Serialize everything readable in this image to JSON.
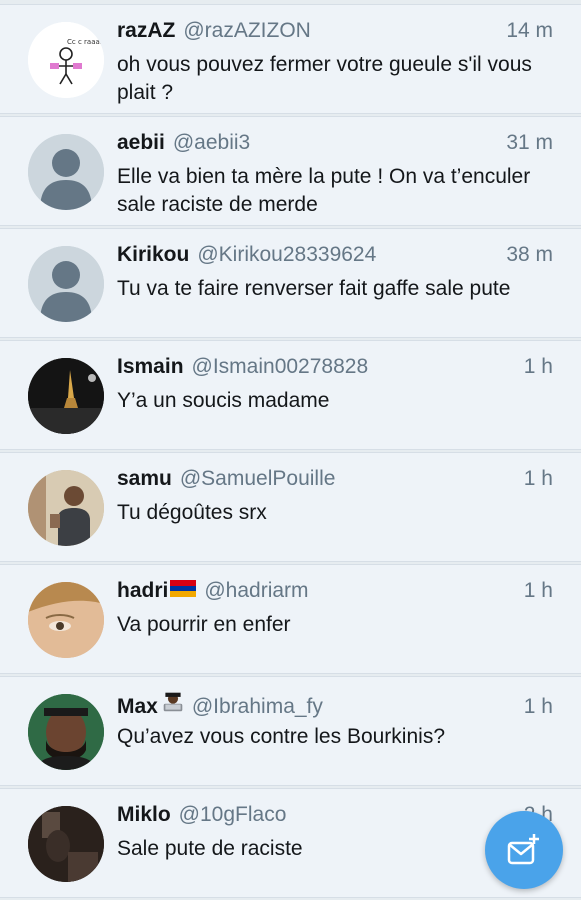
{
  "colors": {
    "background": "#e6ecf0",
    "row_bg": "#eef3f8",
    "accent": "#4aa3ea",
    "name_text": "#14171a",
    "meta_text": "#657786"
  },
  "tweets": [
    {
      "name": "razAZ",
      "handle": "@razAZIZON",
      "time": "14 m",
      "text": "oh vous pouvez fermer votre gueule s'il vous plait ?",
      "avatar_caption": "Cc c raaaz",
      "avatar_icon": "stick-figure-avatar"
    },
    {
      "name": "aebii",
      "handle": "@aebii3",
      "time": "31 m",
      "text": "Elle va bien ta mère la pute ! On va t’enculer sale raciste de merde",
      "avatar_icon": "default-profile-avatar"
    },
    {
      "name": "Kirikou",
      "handle": "@Kirikou28339624",
      "time": "38 m",
      "text": "Tu va te faire renverser fait gaffe sale pute",
      "avatar_icon": "default-profile-avatar"
    },
    {
      "name": "Ismain",
      "handle": "@Ismain00278828",
      "time": "1 h",
      "text": "Y’a un soucis madame",
      "avatar_icon": "eiffel-tower-night-photo"
    },
    {
      "name": "samu",
      "handle": "@SamuelPouille",
      "time": "1 h",
      "text": "Tu dégoûtes srx",
      "avatar_icon": "person-photo"
    },
    {
      "name": "hadri",
      "handle": "@hadriarm",
      "time": "1 h",
      "text": "Va pourrir en enfer",
      "name_emoji": "armenia-flag",
      "avatar_icon": "face-closeup-photo"
    },
    {
      "name": "Max",
      "handle": "@Ibrahima_fy",
      "time": "1 h",
      "text": "Qu’avez vous contre les Bourkinis?",
      "name_emoji": "technologist-emoji",
      "avatar_icon": "man-portrait-photo"
    },
    {
      "name": "Miklo",
      "handle": "@10gFlaco",
      "time": "2 h",
      "text": "Sale pute de raciste",
      "avatar_icon": "dark-photo"
    }
  ],
  "fab": {
    "icon": "compose-message-icon"
  }
}
